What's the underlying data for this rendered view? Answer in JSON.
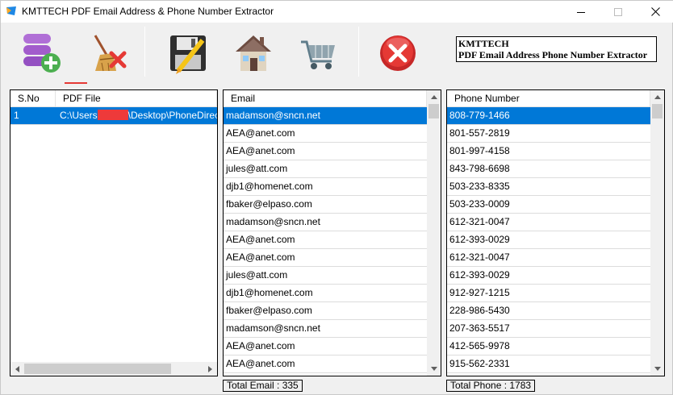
{
  "window": {
    "title": "KMTTECH PDF Email Address & Phone Number Extractor"
  },
  "toolbar": {
    "buttons": [
      {
        "name": "add-pdf",
        "icon": "database-add-icon"
      },
      {
        "name": "clear",
        "icon": "broom-clear-icon"
      },
      {
        "name": "save",
        "icon": "floppy-save-icon"
      },
      {
        "name": "home",
        "icon": "house-icon"
      },
      {
        "name": "buy",
        "icon": "shopping-cart-icon"
      },
      {
        "name": "exit",
        "icon": "red-x-close-icon"
      }
    ],
    "brand_line1": "KMTTECH",
    "brand_line2": "PDF Email Address Phone Number Extractor"
  },
  "files_panel": {
    "col_sno": "S.No",
    "col_file": "PDF File",
    "rows": [
      {
        "sno": "1",
        "path_prefix": "C:\\Users",
        "path_suffix": "\\Desktop\\PhoneDirector"
      }
    ]
  },
  "email_panel": {
    "header": "Email",
    "rows": [
      "madamson@sncn.net",
      "AEA@anet.com",
      "AEA@anet.com",
      "jules@att.com",
      "djb1@homenet.com",
      "fbaker@elpaso.com",
      "madamson@sncn.net",
      "AEA@anet.com",
      "AEA@anet.com",
      "jules@att.com",
      "djb1@homenet.com",
      "fbaker@elpaso.com",
      "madamson@sncn.net",
      "AEA@anet.com",
      "AEA@anet.com"
    ],
    "total_label": "Total Email : 335"
  },
  "phone_panel": {
    "header": "Phone Number",
    "rows": [
      "808-779-1466",
      "801-557-2819",
      "801-997-4158",
      "843-798-6698",
      "503-233-8335",
      " 503-233-0009",
      "612-321-0047",
      "612-393-0029",
      "612-321-0047",
      "612-393-0029",
      "912-927-1215",
      " 228-986-5430",
      "207-363-5517",
      "412-565-9978",
      "915-562-2331"
    ],
    "total_label": "Total Phone : 1783"
  },
  "colors": {
    "selection": "#0078d7",
    "redaction": "#ee3a3a",
    "exit_red": "#d32f2f"
  }
}
